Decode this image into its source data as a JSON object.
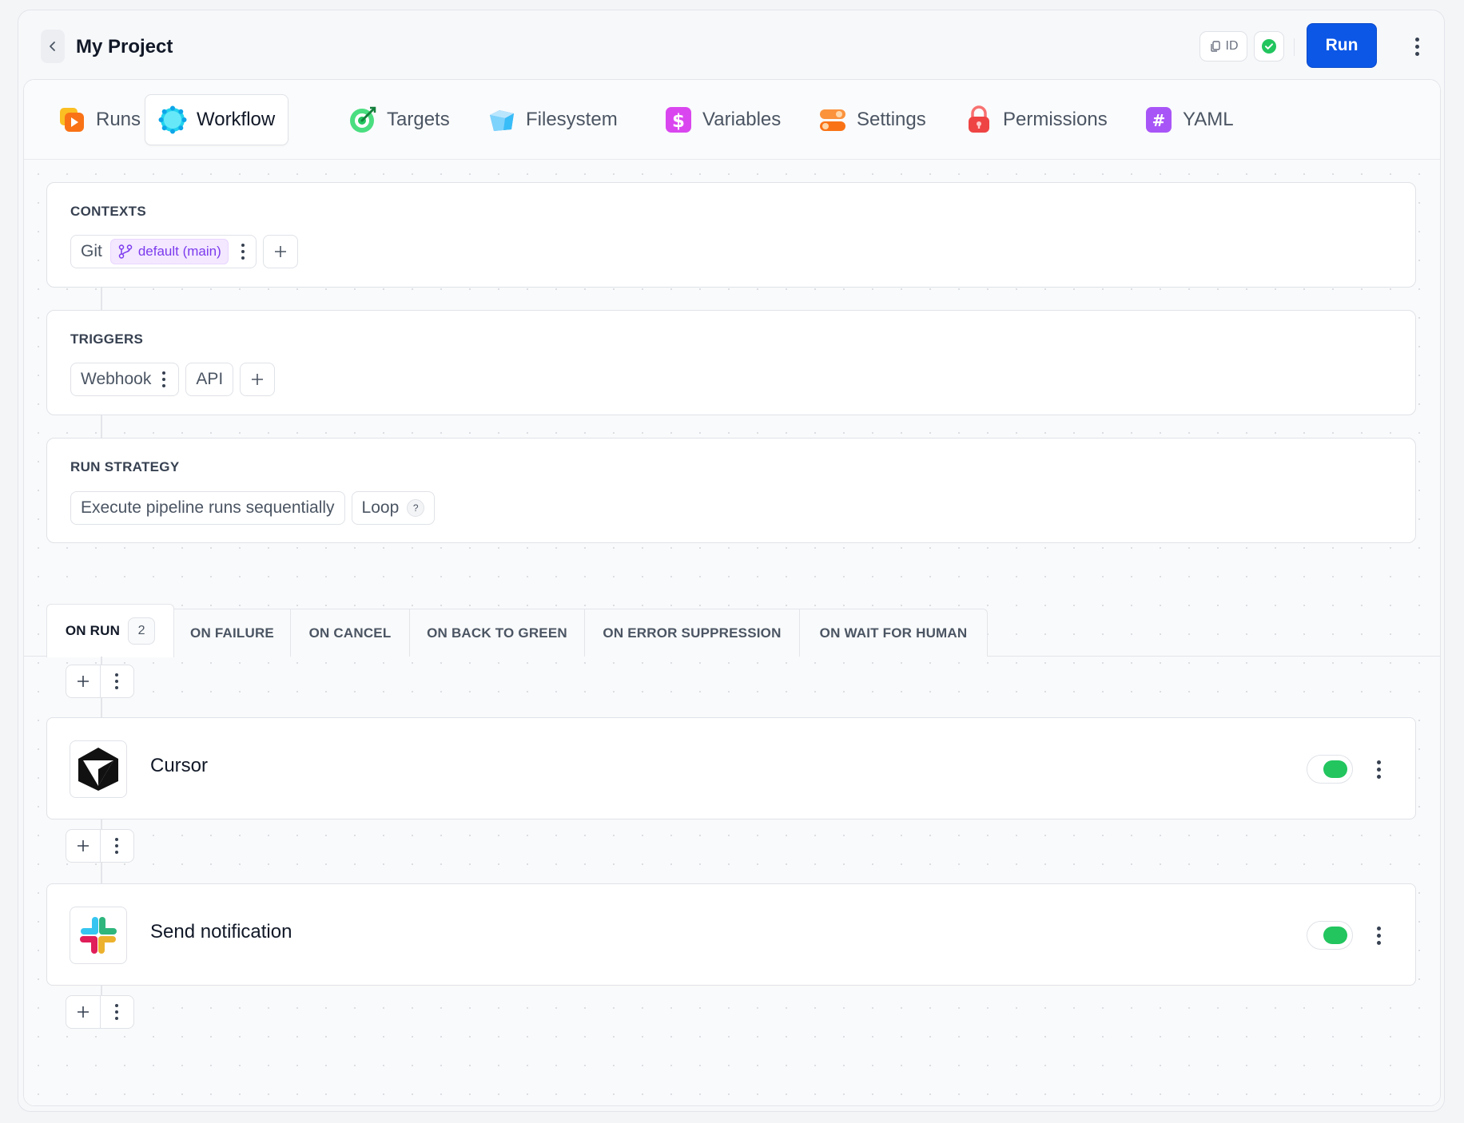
{
  "header": {
    "title": "My Project",
    "id_label": "ID",
    "run_label": "Run"
  },
  "tabs": [
    {
      "label": "Runs",
      "icon": "play-icon"
    },
    {
      "label": "Workflow",
      "icon": "workflow-icon",
      "active": true
    },
    {
      "label": "Targets",
      "icon": "target-icon"
    },
    {
      "label": "Filesystem",
      "icon": "filesystem-icon"
    },
    {
      "label": "Variables",
      "icon": "dollar-icon"
    },
    {
      "label": "Settings",
      "icon": "toggles-icon"
    },
    {
      "label": "Permissions",
      "icon": "lock-icon"
    },
    {
      "label": "YAML",
      "icon": "hash-icon"
    }
  ],
  "contexts": {
    "title": "CONTEXTS",
    "git_label": "Git",
    "branch": "default (main)"
  },
  "triggers": {
    "title": "TRIGGERS",
    "items": [
      "Webhook",
      "API"
    ]
  },
  "run_strategy": {
    "title": "RUN STRATEGY",
    "mode": "Execute pipeline runs sequentially",
    "loop_label": "Loop",
    "help": "?"
  },
  "event_tabs": [
    {
      "label": "ON RUN",
      "count": "2",
      "active": true
    },
    {
      "label": "ON FAILURE"
    },
    {
      "label": "ON CANCEL"
    },
    {
      "label": "ON BACK TO GREEN"
    },
    {
      "label": "ON ERROR SUPPRESSION"
    },
    {
      "label": "ON WAIT FOR HUMAN"
    }
  ],
  "steps": [
    {
      "name": "Cursor",
      "icon": "cursor-logo-icon",
      "enabled": true
    },
    {
      "name": "Send notification",
      "icon": "slack-logo-icon",
      "enabled": true
    }
  ],
  "colors": {
    "accent": "#0c57e6",
    "success": "#22c55e",
    "branch": "#7c3aed"
  }
}
